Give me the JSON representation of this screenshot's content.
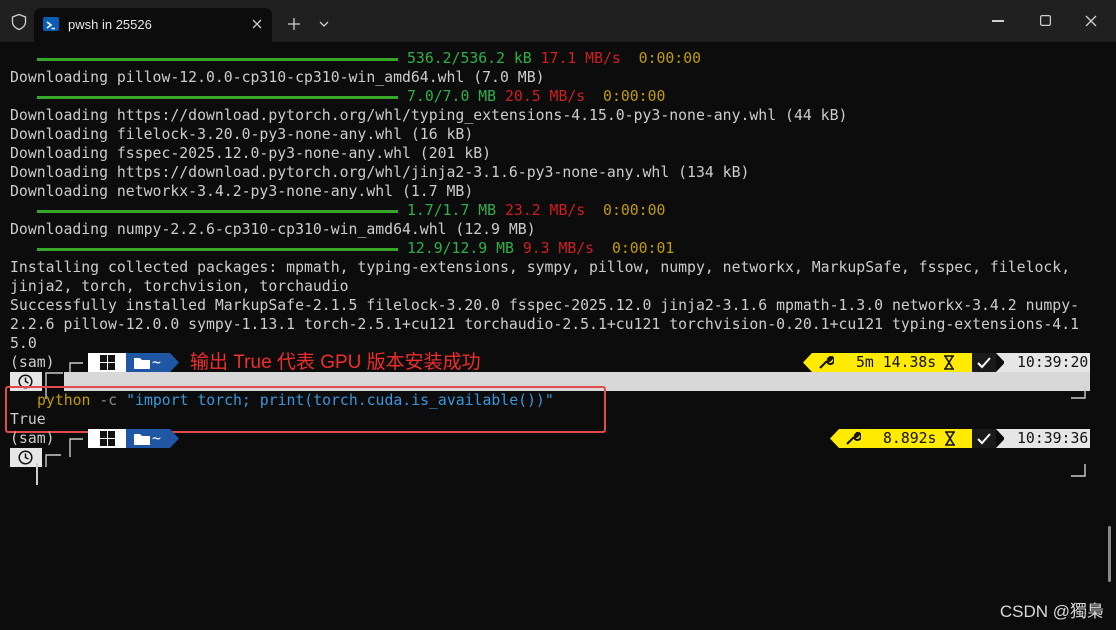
{
  "window": {
    "tab_title": "pwsh in 25526"
  },
  "icons": {
    "shield": "shield-icon",
    "terminal": "powershell-icon",
    "add": "plus-icon",
    "dropdown": "chevron-down-icon",
    "close": "close-icon",
    "minimize": "minimize-icon",
    "maximize": "maximize-icon"
  },
  "colors": {
    "progress": "#37a82a",
    "size_green": "#30b04a",
    "speed_red": "#d01e22",
    "eta_yellow": "#c19c00",
    "path_segment": "#1f57a4",
    "exec_segment": "#ffea00",
    "annotation_red": "#f12d2d"
  },
  "progress1": {
    "fill": 1.0,
    "size": "536.2/536.2 kB",
    "speed": "17.1 MB/s",
    "eta": "0:00:00"
  },
  "line_pillow": "Downloading pillow-12.0.0-cp310-cp310-win_amd64.whl (7.0 MB)",
  "progress2": {
    "fill": 1.0,
    "size": "7.0/7.0 MB",
    "speed": "20.5 MB/s",
    "eta": "0:00:00"
  },
  "line_typing": "Downloading https://download.pytorch.org/whl/typing_extensions-4.15.0-py3-none-any.whl (44 kB)",
  "line_filelock": "Downloading filelock-3.20.0-py3-none-any.whl (16 kB)",
  "line_fsspec": "Downloading fsspec-2025.12.0-py3-none-any.whl (201 kB)",
  "line_jinja2": "Downloading https://download.pytorch.org/whl/jinja2-3.1.6-py3-none-any.whl (134 kB)",
  "line_networkx": "Downloading networkx-3.4.2-py3-none-any.whl (1.7 MB)",
  "progress3": {
    "fill": 1.0,
    "size": "1.7/1.7 MB",
    "speed": "23.2 MB/s",
    "eta": "0:00:00"
  },
  "line_numpy": "Downloading numpy-2.2.6-cp310-cp310-win_amd64.whl (12.9 MB)",
  "progress4": {
    "fill": 1.0,
    "size": "12.9/12.9 MB",
    "speed": "9.3 MB/s",
    "eta": "0:00:01"
  },
  "installing": [
    "Installing collected packages: mpmath, typing-extensions, sympy, pillow, numpy, networkx, MarkupSafe, fsspec, filelock,",
    "jinja2, torch, torchvision, torchaudio"
  ],
  "success": [
    "Successfully installed MarkupSafe-2.1.5 filelock-3.20.0 fsspec-2025.12.0 jinja2-3.1.6 mpmath-1.3.0 networkx-3.4.2 numpy-",
    "2.2.6 pillow-12.0.0 sympy-1.13.1 torch-2.5.1+cu121 torchaudio-2.5.1+cu121 torchvision-0.20.1+cu121 typing-extensions-4.1",
    "5.0"
  ],
  "prompt1": {
    "env": "(sam)",
    "path": "~",
    "duration": "5m 14.38s",
    "time": "10:39:20"
  },
  "annotation": "输出 True 代表 GPU 版本安装成功",
  "command": {
    "exe": "python",
    "flag": "-c",
    "arg": "\"import torch; print(torch.cuda.is_available())\""
  },
  "output": "True",
  "prompt2": {
    "env": "(sam)",
    "path": "~",
    "duration": "8.892s",
    "time": "10:39:36"
  },
  "watermark": "CSDN @獨梟"
}
